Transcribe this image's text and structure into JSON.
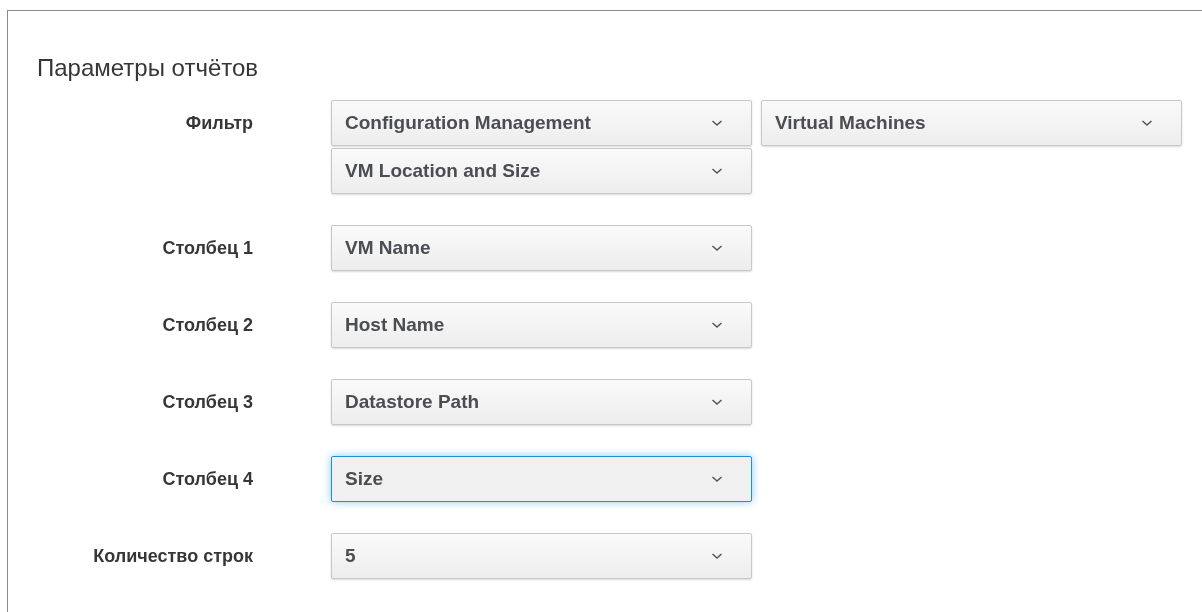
{
  "title": "Параметры отчётов",
  "rows": [
    {
      "label": "Фильтр",
      "selects": [
        {
          "value": "Configuration Management",
          "focused": false
        },
        {
          "value": "Virtual Machines",
          "focused": false
        },
        {
          "value": "VM Location and Size",
          "focused": false
        }
      ]
    },
    {
      "label": "Столбец 1",
      "selects": [
        {
          "value": "VM Name",
          "focused": false
        }
      ]
    },
    {
      "label": "Столбец 2",
      "selects": [
        {
          "value": "Host Name",
          "focused": false
        }
      ]
    },
    {
      "label": "Столбец 3",
      "selects": [
        {
          "value": "Datastore Path",
          "focused": false
        }
      ]
    },
    {
      "label": "Столбец 4",
      "selects": [
        {
          "value": "Size",
          "focused": true
        }
      ]
    },
    {
      "label": "Количество строк",
      "selects": [
        {
          "value": "5",
          "focused": false
        }
      ]
    }
  ]
}
